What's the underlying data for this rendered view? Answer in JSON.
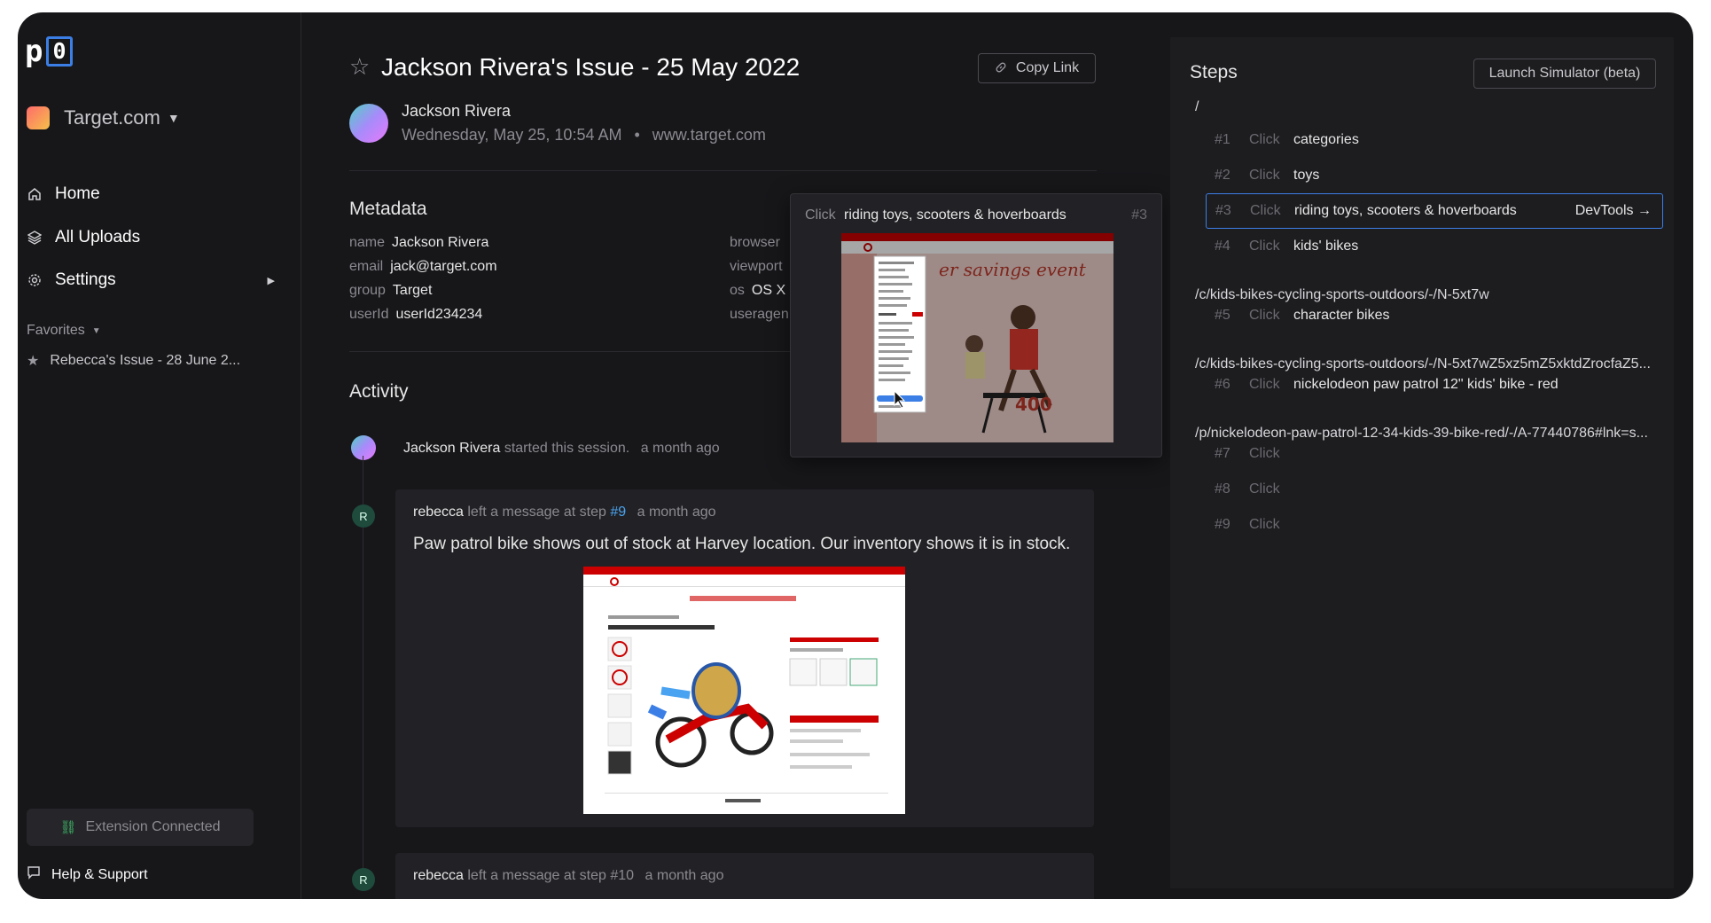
{
  "app": {
    "logo_letter": "p",
    "logo_box": "0",
    "workspace": "Target.com"
  },
  "sidebar": {
    "nav": [
      {
        "label": "Home",
        "icon": "home-icon"
      },
      {
        "label": "All Uploads",
        "icon": "layers-icon"
      },
      {
        "label": "Settings",
        "icon": "gear-icon"
      }
    ],
    "favorites_label": "Favorites",
    "favorites": [
      {
        "label": "Rebecca's Issue - 28 June 2..."
      }
    ],
    "extension_status": "Extension Connected",
    "help_label": "Help & Support"
  },
  "issue": {
    "title": "Jackson Rivera's Issue - 25 May 2022",
    "copy_link_label": "Copy Link",
    "user_name": "Jackson Rivera",
    "datetime": "Wednesday, May 25, 10:54 AM",
    "bullet": "•",
    "site": "www.target.com"
  },
  "metadata": {
    "title": "Metadata",
    "left": [
      {
        "key": "name",
        "value": "Jackson Rivera"
      },
      {
        "key": "email",
        "value": "jack@target.com"
      },
      {
        "key": "group",
        "value": "Target"
      },
      {
        "key": "userId",
        "value": "userId234234"
      }
    ],
    "right": [
      {
        "key": "browser",
        "value": ""
      },
      {
        "key": "viewport",
        "value": ""
      },
      {
        "key": "os",
        "value": "OS X"
      },
      {
        "key": "useragen",
        "value": ""
      }
    ]
  },
  "activity": {
    "title": "Activity",
    "session": {
      "who": "Jackson Rivera",
      "text": "started this session.",
      "time": "a month ago"
    },
    "messages": [
      {
        "avatar": "R",
        "who": "rebecca",
        "text": "left a message at step",
        "step": "#9",
        "time": "a month ago",
        "body": "Paw patrol bike shows out of stock at Harvey location. Our inventory shows it is in stock."
      },
      {
        "avatar": "R",
        "who": "rebecca",
        "text": "left a message at step",
        "step": "#10",
        "time": "a month ago"
      }
    ]
  },
  "preview": {
    "action": "Click",
    "label": "riding toys, scooters & hoverboards",
    "num": "#3",
    "shot_price": "400"
  },
  "steps": {
    "title": "Steps",
    "simulator_label": "Launch Simulator (beta)",
    "devtools_label": "DevTools",
    "paths": [
      "/",
      "/c/kids-bikes-cycling-sports-outdoors/-/N-5xt7w",
      "/c/kids-bikes-cycling-sports-outdoors/-/N-5xt7wZ5xz5mZ5xktdZrocfaZ5...",
      "/p/nickelodeon-paw-patrol-12-34-kids-39-bike-red/-/A-77440786#lnk=s..."
    ],
    "items": [
      {
        "num": "#1",
        "action": "Click",
        "label": "categories"
      },
      {
        "num": "#2",
        "action": "Click",
        "label": "toys"
      },
      {
        "num": "#3",
        "action": "Click",
        "label": "riding toys, scooters & hoverboards",
        "active": true
      },
      {
        "num": "#4",
        "action": "Click",
        "label": "kids' bikes"
      },
      {
        "num": "#5",
        "action": "Click",
        "label": "character bikes"
      },
      {
        "num": "#6",
        "action": "Click",
        "label": "nickelodeon paw patrol 12\" kids' bike - red"
      },
      {
        "num": "#7",
        "action": "Click",
        "label": ""
      },
      {
        "num": "#8",
        "action": "Click",
        "label": ""
      },
      {
        "num": "#9",
        "action": "Click",
        "label": ""
      }
    ]
  }
}
